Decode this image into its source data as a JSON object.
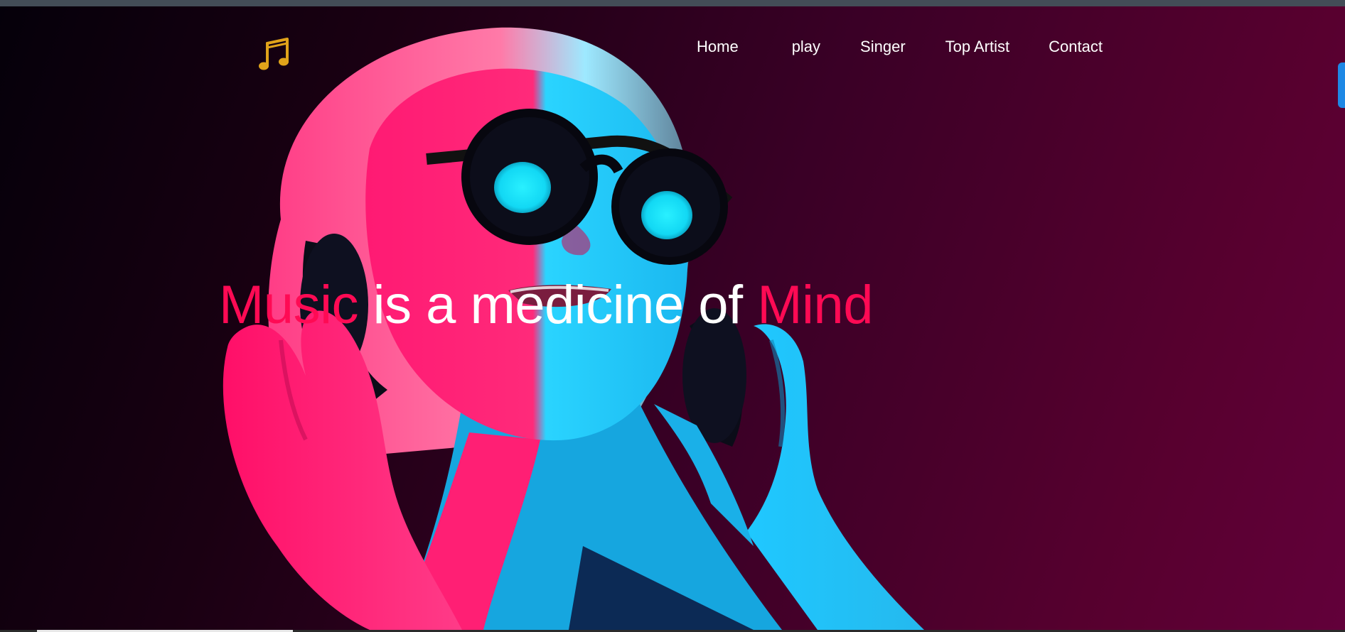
{
  "header": {
    "logo_icon": "music-note-icon",
    "logo_color": "#e0a31a",
    "nav": [
      {
        "label": "Home"
      },
      {
        "label": "play"
      },
      {
        "label": "Singer"
      },
      {
        "label": "Top Artist"
      },
      {
        "label": "Contact"
      }
    ]
  },
  "hero": {
    "headline_parts": [
      {
        "text": "Music",
        "accent": true
      },
      {
        "text": " is a medicine of ",
        "accent": false
      },
      {
        "text": "Mind",
        "accent": true
      }
    ],
    "image": "woman-with-headphones-neon-portrait"
  },
  "colors": {
    "accent": "#ff0a54",
    "nav_text": "#ffffff",
    "background_dark": "#05000a",
    "background_magenta": "#62003a",
    "side_tab": "#1e88e5"
  }
}
